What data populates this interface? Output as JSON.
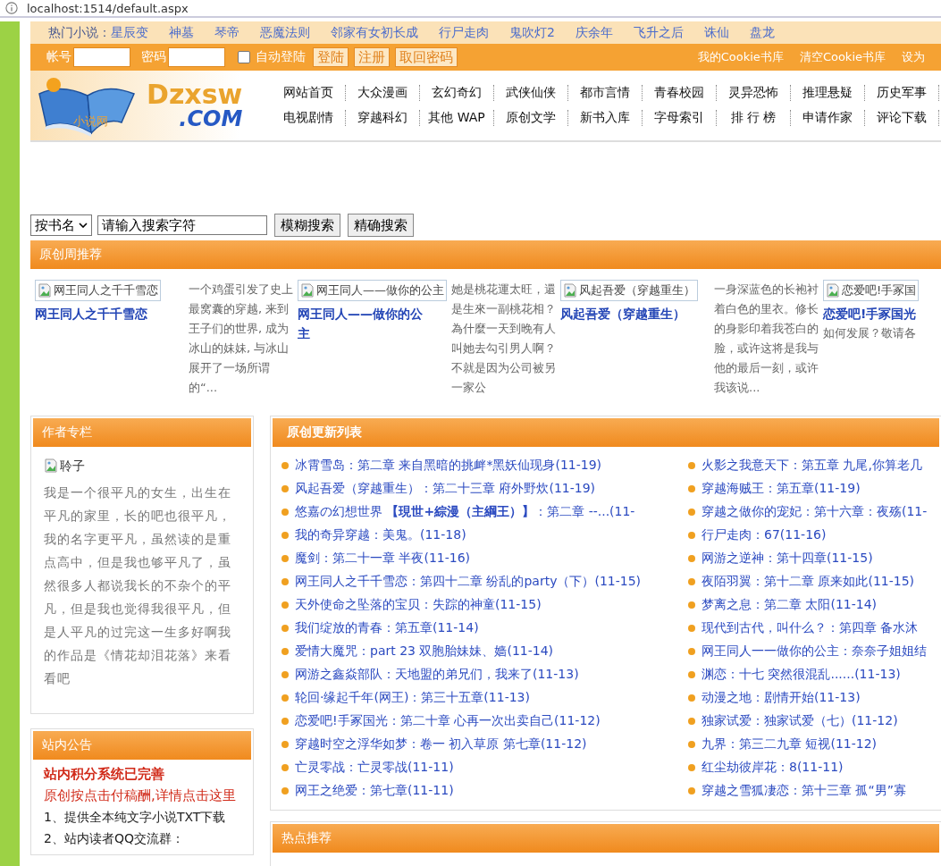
{
  "address_bar": {
    "url": "localhost:1514/default.aspx"
  },
  "hot_novels": {
    "label": "热门小说：",
    "links": [
      "星辰变",
      "神墓",
      "琴帝",
      "恶魔法则",
      "邻家有女初长成",
      "行尸走肉",
      "鬼吹灯2",
      "庆余年",
      "飞升之后",
      "诛仙",
      "盘龙"
    ]
  },
  "login": {
    "account_label": "帐号",
    "password_label": "密码",
    "auto_login": {
      "label": "自动登陆",
      "checked": false
    },
    "buttons": [
      "登陆",
      "注册",
      "取回密码"
    ],
    "links": [
      "我的Cookie书库",
      "清空Cookie书库",
      "设为"
    ]
  },
  "logo": {
    "name": "Dzxsw",
    "domain": ".COM",
    "tagline": "小说网"
  },
  "nav": [
    [
      "网站首页",
      "大众漫画",
      "玄幻奇幻",
      "武侠仙侠",
      "都市言情",
      "青春校园",
      "灵异恐怖",
      "推理悬疑",
      "历史军事"
    ],
    [
      "电视剧情",
      "穿越科幻",
      "其他 WAP",
      "原创文学",
      "新书入库",
      "字母索引",
      "排 行 榜",
      "申请作家",
      "评论下载"
    ]
  ],
  "search": {
    "mode": "按书名",
    "value": "请输入搜索字符",
    "buttons": [
      "模糊搜索",
      "精确搜索"
    ]
  },
  "weekly": {
    "title": "原创周推荐",
    "books": [
      {
        "image_alt": "网王同人之千千雪恋",
        "title": "网王同人之千千雪恋",
        "summary": "一个鸡蛋引发了史上最窝囊的穿越, 来到王子们的世界, 成为冰山的妹妹, 与冰山展开了一场所谓的“..."
      },
      {
        "image_alt": "网王同人——做你的公主",
        "title": "网王同人——做你的公主",
        "summary": "她是桃花運太旺，還是生來一副桃花相？為什麼一天到晚有人叫她去勾引男人啊？不就是因为公司被另一家公"
      },
      {
        "image_alt": "风起吾爱（穿越重生）",
        "title": "风起吾爱（穿越重生）",
        "summary": "一身深蓝色的长袍衬着白色的里衣。修长的身影印着我苍白的脸，或许这将是我与他的最后一刻，或许我该说..."
      },
      {
        "image_alt": "恋爱吧!手冢国",
        "title": "恋爱吧!手冢国光",
        "summary": "如何发展？敬请各"
      }
    ]
  },
  "author_column": {
    "title": "作者专栏",
    "image_alt": "聆子",
    "bio": "我是一个很平凡的女生，出生在平凡的家里，长的吧也很平凡，我的名字更平凡，虽然读的是重点高中，但是我也够平凡了，虽然很多人都说我长的不杂个的平凡，但是我也觉得我很平凡，但是人平凡的过完这一生多好啊我的作品是《情花却泪花落》来看看吧"
  },
  "notice": {
    "title": "站内公告",
    "items": [
      {
        "kind": "headline",
        "text": "站内积分系统已完善"
      },
      {
        "kind": "link",
        "text": "原创按点击付稿酬,详情点击这里"
      },
      {
        "kind": "line",
        "text": "1、提供全本纯文字小说TXT下载"
      },
      {
        "kind": "line",
        "text": "2、站内读者QQ交流群："
      }
    ]
  },
  "updates": {
    "title": "原创更新列表",
    "columns": [
      [
        "冰霄雪岛：第二章 来自黑暗的挑衅*黑妖仙现身(11-19)",
        "风起吾爱（穿越重生）：第二十三章 府外野炊(11-19)",
        "悠嘉の幻想世界 **【現世+綜漫（主綱王）】**：第二章 --...(11-",
        "我的奇异穿越：美鬼。(11-18)",
        "魔剑：第二十一章 半夜(11-16)",
        "网王同人之千千雪恋：第四十二章 纷乱的party（下）(11-15)",
        "天外使命之坠落的宝贝：失踪的神童(11-15)",
        "我们绽放的青春：第五章(11-14)",
        "爱情大魔咒：part 23 双胞胎妹妹、嫱(11-14)",
        "网游之鑫焱部队：天地盟的弟兄们，我来了(11-13)",
        "轮回·缘起千年(网王)：第三十五章(11-13)",
        "恋爱吧!手冢国光：第二十章 心再一次出卖自己(11-12)",
        "穿越时空之浮华如梦：卷一 初入草原 第七章(11-12)",
        "亡灵零战：亡灵零战(11-11)",
        "网王之绝爱：第七章(11-11)"
      ],
      [
        "火影之我意天下：第五章 九尾,你算老几",
        "穿越海贼王：第五章(11-19)",
        "穿越之做你的宠妃：第十六章：夜殇(11-",
        "行尸走肉：67(11-16)",
        "网游之逆神：第十四章(11-15)",
        "夜陌羽翼：第十二章 原来如此(11-15)",
        "梦离之息：第二章 太阳(11-14)",
        "现代到古代，叫什么？：第四章 备水沐",
        "网王同人一一做你的公主：奈奈子姐姐结",
        "渊恋：十七 突然很混乱......(11-13)",
        "动漫之地：剧情开始(11-13)",
        "独家试爱：独家试爱（七）(11-12)",
        "九界：第三二九章 短视(11-12)",
        "红尘劫彼岸花：8(11-11)",
        "穿越之雪狐凄恋：第十三章 孤“男”寡"
      ]
    ]
  },
  "hot": {
    "title": "热点推荐"
  }
}
